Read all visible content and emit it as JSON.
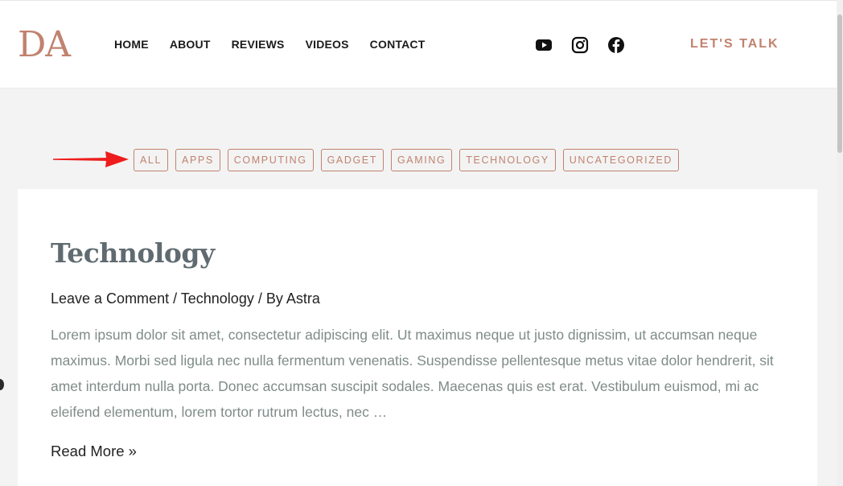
{
  "header": {
    "logo_text": "DA",
    "nav": [
      "HOME",
      "ABOUT",
      "REVIEWS",
      "VIDEOS",
      "CONTACT"
    ],
    "social_icons": [
      "youtube-icon",
      "instagram-icon",
      "facebook-icon"
    ],
    "cta_label": "LET'S TALK"
  },
  "filters": {
    "categories": [
      "ALL",
      "APPS",
      "COMPUTING",
      "GADGET",
      "GAMING",
      "TECHNOLOGY",
      "UNCATEGORIZED"
    ]
  },
  "post": {
    "title": "Technology",
    "meta_comment": "Leave a Comment",
    "meta_sep1": " / ",
    "meta_category": "Technology",
    "meta_sep2": " / By ",
    "meta_author": "Astra",
    "excerpt": "Lorem ipsum dolor sit amet, consectetur adipiscing elit. Ut maximus neque ut justo dignissim, ut accumsan neque maximus. Morbi sed ligula nec nulla fermentum venenatis. Suspendisse pellentesque metus vitae dolor hendrerit, sit amet interdum nulla porta. Donec accumsan suscipit sodales. Maecenas quis est erat. Vestibulum euismod, mi ac eleifend elementum, lorem tortor rutrum lectus, nec …",
    "read_more": "Read More »"
  },
  "colors": {
    "accent": "#c1826e",
    "title": "#5f6b70",
    "body_text": "#7f8c89",
    "page_bg": "#f3f3f3",
    "annotation_arrow": "#ee1c1c"
  }
}
